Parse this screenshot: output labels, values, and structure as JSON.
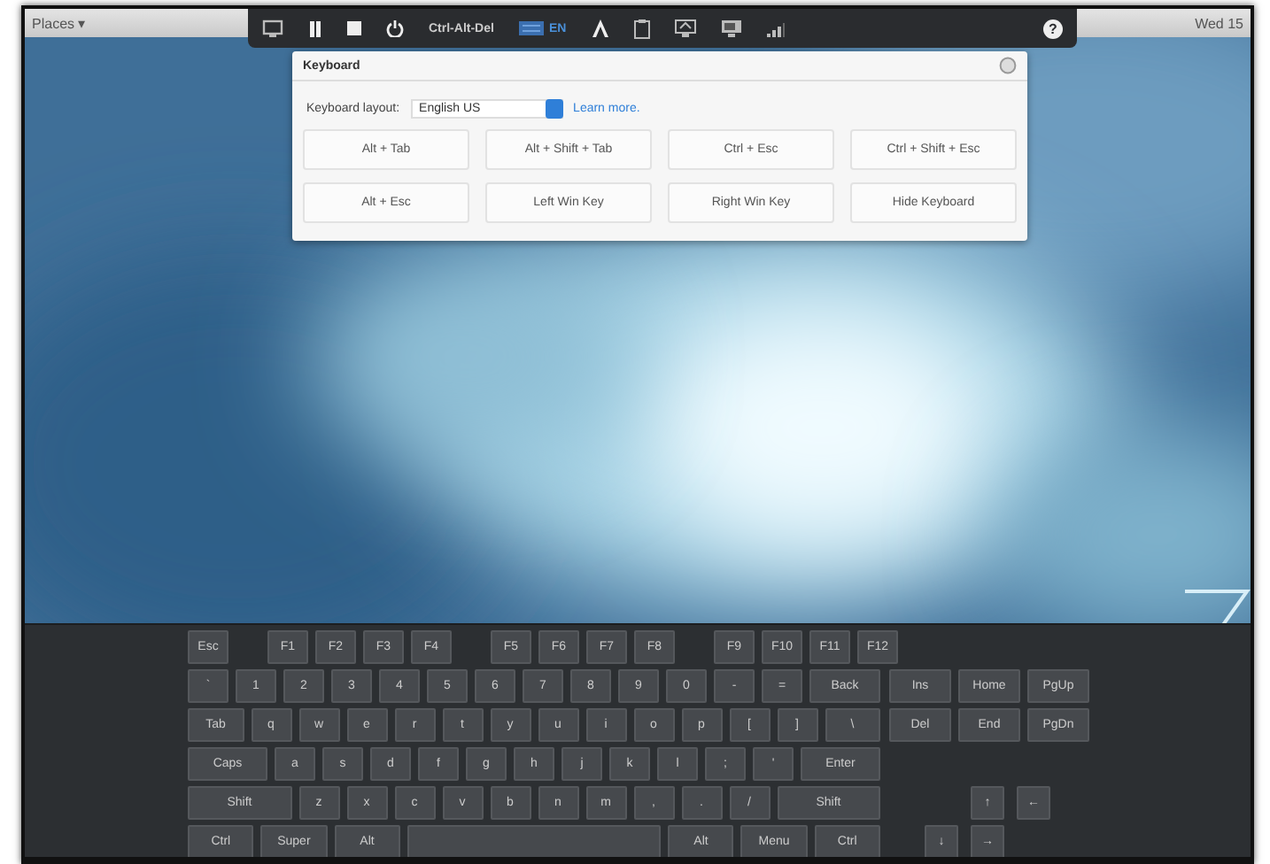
{
  "top_panel": {
    "places": "Places ▾",
    "clock": "Wed 15"
  },
  "toolbar": {
    "ctrl_alt_del": "Ctrl-Alt-Del",
    "language": "EN",
    "help": "?"
  },
  "keyboard_dialog": {
    "title": "Keyboard",
    "layout_label": "Keyboard layout:",
    "layout_value": "English US",
    "learn_more": "Learn more.",
    "buttons": [
      "Alt + Tab",
      "Alt + Shift + Tab",
      "Ctrl + Esc",
      "Ctrl + Shift + Esc",
      "Alt + Esc",
      "Left Win Key",
      "Right Win Key",
      "Hide Keyboard"
    ]
  },
  "on_screen_keyboard": {
    "function_row": [
      [
        "Esc"
      ],
      [
        "F1",
        "F2",
        "F3",
        "F4"
      ],
      [
        "F5",
        "F6",
        "F7",
        "F8"
      ],
      [
        "F9",
        "F10",
        "F11",
        "F12"
      ]
    ],
    "main_rows": [
      [
        {
          "label": "`",
          "kind": "key"
        },
        {
          "label": "1",
          "kind": "key"
        },
        {
          "label": "2",
          "kind": "key"
        },
        {
          "label": "3",
          "kind": "key"
        },
        {
          "label": "4",
          "kind": "key"
        },
        {
          "label": "5",
          "kind": "key"
        },
        {
          "label": "6",
          "kind": "key"
        },
        {
          "label": "7",
          "kind": "key"
        },
        {
          "label": "8",
          "kind": "key"
        },
        {
          "label": "9",
          "kind": "key"
        },
        {
          "label": "0",
          "kind": "key"
        },
        {
          "label": "-",
          "kind": "key"
        },
        {
          "label": "=",
          "kind": "key"
        },
        {
          "label": "Back",
          "kind": "wide"
        }
      ],
      [
        {
          "label": "Tab",
          "kind": "wide"
        },
        {
          "label": "q",
          "kind": "key"
        },
        {
          "label": "w",
          "kind": "key"
        },
        {
          "label": "e",
          "kind": "key"
        },
        {
          "label": "r",
          "kind": "key"
        },
        {
          "label": "t",
          "kind": "key"
        },
        {
          "label": "y",
          "kind": "key"
        },
        {
          "label": "u",
          "kind": "key"
        },
        {
          "label": "i",
          "kind": "key"
        },
        {
          "label": "o",
          "kind": "key"
        },
        {
          "label": "p",
          "kind": "key"
        },
        {
          "label": "[",
          "kind": "key"
        },
        {
          "label": "]",
          "kind": "key"
        },
        {
          "label": "\\",
          "kind": "wide"
        }
      ],
      [
        {
          "label": "Caps",
          "kind": "wide"
        },
        {
          "label": "a",
          "kind": "key"
        },
        {
          "label": "s",
          "kind": "key"
        },
        {
          "label": "d",
          "kind": "key"
        },
        {
          "label": "f",
          "kind": "key"
        },
        {
          "label": "g",
          "kind": "key"
        },
        {
          "label": "h",
          "kind": "key"
        },
        {
          "label": "j",
          "kind": "key"
        },
        {
          "label": "k",
          "kind": "key"
        },
        {
          "label": "l",
          "kind": "key"
        },
        {
          "label": ";",
          "kind": "key"
        },
        {
          "label": "'",
          "kind": "key"
        },
        {
          "label": "Enter",
          "kind": "wide"
        }
      ],
      [
        {
          "label": "Shift",
          "kind": "wide"
        },
        {
          "label": "z",
          "kind": "key"
        },
        {
          "label": "x",
          "kind": "key"
        },
        {
          "label": "c",
          "kind": "key"
        },
        {
          "label": "v",
          "kind": "key"
        },
        {
          "label": "b",
          "kind": "key"
        },
        {
          "label": "n",
          "kind": "key"
        },
        {
          "label": "m",
          "kind": "key"
        },
        {
          "label": ",",
          "kind": "key"
        },
        {
          "label": ".",
          "kind": "key"
        },
        {
          "label": "/",
          "kind": "key"
        },
        {
          "label": "Shift",
          "kind": "wide"
        }
      ],
      [
        {
          "label": "Ctrl",
          "kind": "wide"
        },
        {
          "label": "Super",
          "kind": "wide"
        },
        {
          "label": "Alt",
          "kind": "wide"
        },
        {
          "kind": "space"
        },
        {
          "label": "Alt",
          "kind": "wide"
        },
        {
          "label": "Menu",
          "kind": "wide"
        },
        {
          "label": "Ctrl",
          "kind": "wide"
        }
      ]
    ],
    "nav_keys": [
      "Ins",
      "Home",
      "PgUp",
      "Del",
      "End",
      "PgDn"
    ],
    "arrow_keys": {
      "up": "↑",
      "left": "←",
      "down": "↓",
      "right": "→"
    }
  }
}
